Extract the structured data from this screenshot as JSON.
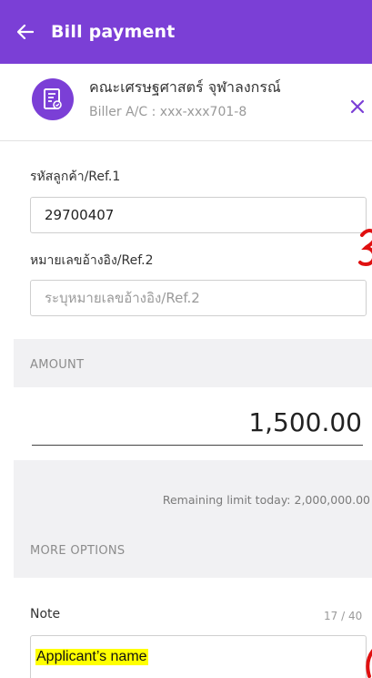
{
  "header": {
    "back_icon": "arrow-left-icon",
    "title": "Bill payment",
    "color": "#7b3fd6"
  },
  "biller": {
    "icon": "bill-receipt-icon",
    "name": "คณะเศรษฐศาสตร์ จุฬาลงกรณ์",
    "account": "Biller A/C : xxx-xxx701-8",
    "close_icon": "close-icon"
  },
  "ref1": {
    "label": "รหัสลูกค้า/Ref.1",
    "value": "29700407"
  },
  "ref2": {
    "label": "หมายเลขอ้างอิง/Ref.2",
    "placeholder": "ระบุหมายเลขอ้างอิง/Ref.2"
  },
  "amount": {
    "section_title": "AMOUNT",
    "value": "1,500.00",
    "remaining": "Remaining limit today: 2,000,000.00"
  },
  "more_options": {
    "section_title": "MORE OPTIONS"
  },
  "note": {
    "label": "Note",
    "count": "17 / 40",
    "value": "Applicant’s name",
    "highlight_color": "#ffff00"
  },
  "annotation_color": "#e01010"
}
